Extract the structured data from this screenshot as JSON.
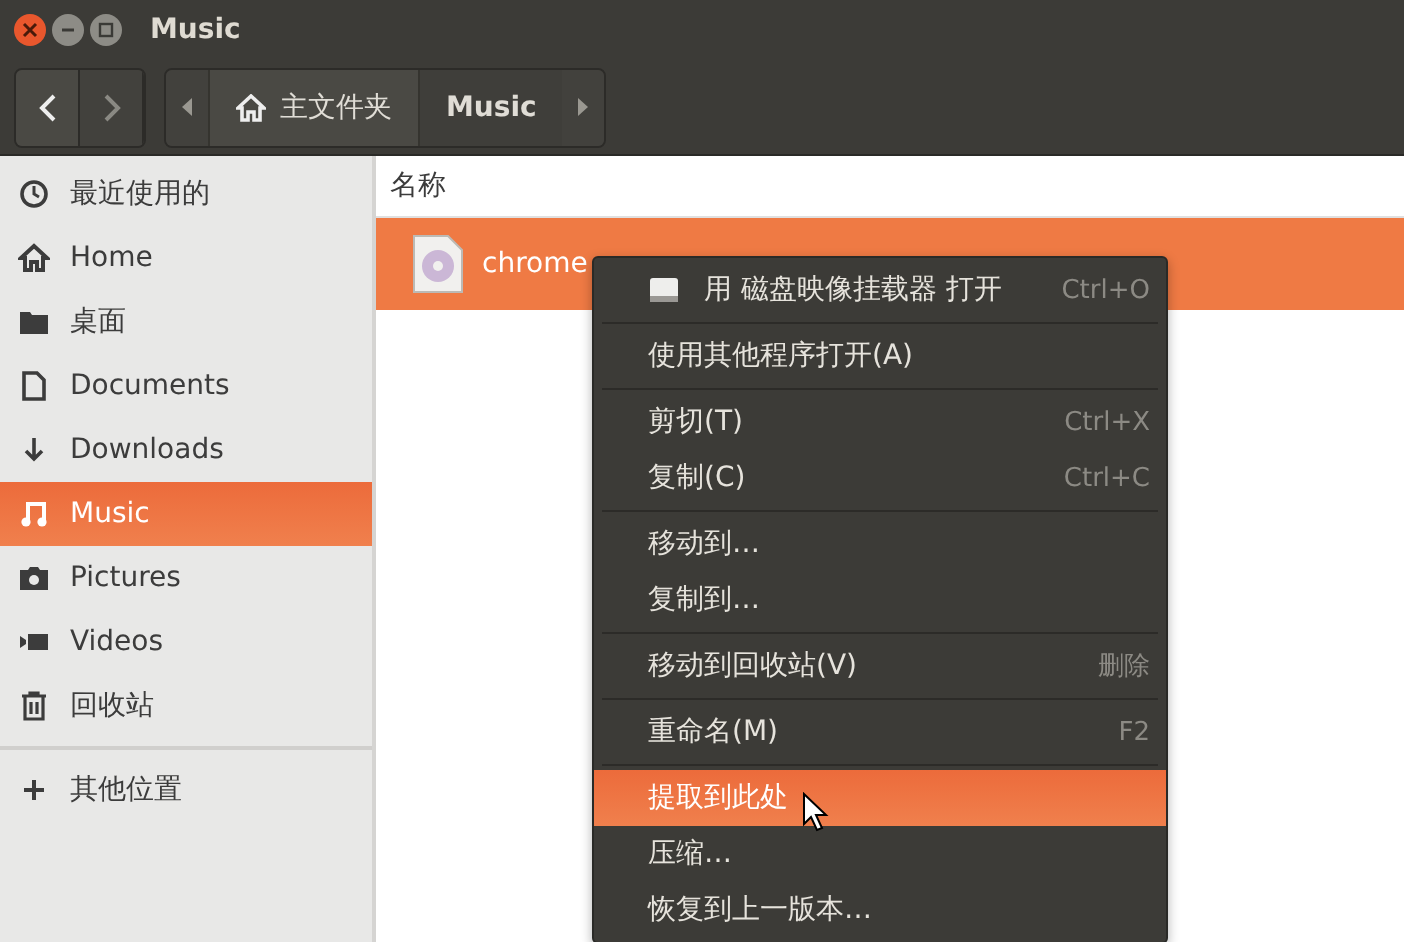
{
  "window": {
    "title": "Music"
  },
  "navigation": {
    "back_disabled": false,
    "forward_disabled": true
  },
  "path_bar": [
    {
      "label": "主文件夹",
      "kind": "home",
      "selected": false
    },
    {
      "label": "Music",
      "kind": "plain",
      "selected": true
    }
  ],
  "sidebar": {
    "items": [
      {
        "label": "最近使用的",
        "selected": false
      },
      {
        "label": "Home",
        "selected": false
      },
      {
        "label": "桌面",
        "selected": false
      },
      {
        "label": "Documents",
        "selected": false
      },
      {
        "label": "Downloads",
        "selected": false
      },
      {
        "label": "Music",
        "selected": true
      },
      {
        "label": "Pictures",
        "selected": false
      },
      {
        "label": "Videos",
        "selected": false
      },
      {
        "label": "回收站",
        "selected": false
      }
    ],
    "other": {
      "label": "其他位置",
      "selected": false
    }
  },
  "file_list": {
    "column": "名称",
    "files": [
      {
        "name": "chrome",
        "selected": true
      }
    ]
  },
  "context_menu": {
    "sections": [
      [
        {
          "label": "用 磁盘映像挂载器 打开",
          "shortcut": "Ctrl+O",
          "kind": "icon",
          "selected": false
        }
      ],
      [
        {
          "label": "使用其他程序打开(A)",
          "kind": "plain",
          "selected": false
        }
      ],
      [
        {
          "label": "剪切(T)",
          "shortcut": "Ctrl+X",
          "kind": "plain",
          "selected": false
        },
        {
          "label": "复制(C)",
          "shortcut": "Ctrl+C",
          "kind": "plain",
          "selected": false
        }
      ],
      [
        {
          "label": "移动到…",
          "kind": "plain",
          "selected": false
        },
        {
          "label": "复制到…",
          "kind": "plain",
          "selected": false
        }
      ],
      [
        {
          "label": "移动到回收站(V)",
          "shortcut": "删除",
          "kind": "plain",
          "selected": false
        }
      ],
      [
        {
          "label": "重命名(M)",
          "shortcut": "F2",
          "kind": "plain",
          "selected": false
        }
      ],
      [
        {
          "label": "提取到此处",
          "kind": "plain",
          "selected": true
        },
        {
          "label": "压缩…",
          "kind": "plain",
          "selected": false
        },
        {
          "label": "恢复到上一版本…",
          "kind": "plain",
          "selected": false
        }
      ]
    ]
  }
}
